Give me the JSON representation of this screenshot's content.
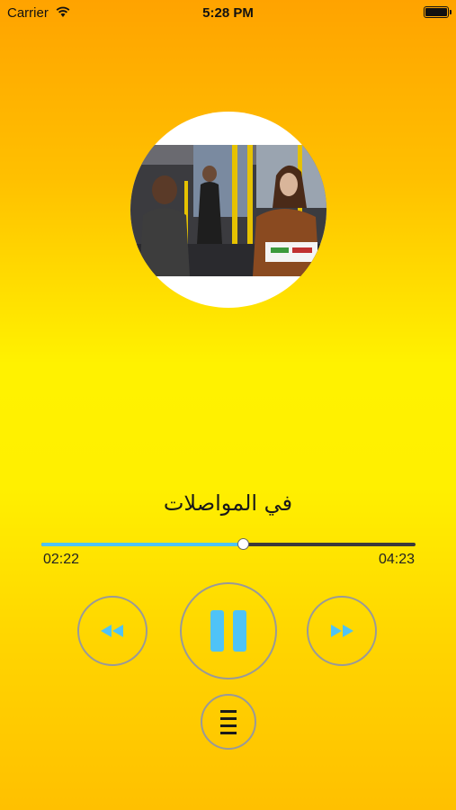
{
  "status_bar": {
    "carrier": "Carrier",
    "time": "5:28 PM",
    "icons": [
      "wifi-icon",
      "battery-icon"
    ]
  },
  "player": {
    "track_title": "في المواصلات",
    "elapsed": "02:22",
    "duration": "04:23",
    "progress_fraction": 0.54,
    "state": "playing"
  },
  "colors": {
    "accent": "#4fc3f7",
    "track_bg": "#3a3a3a",
    "button_border": "#999999",
    "background_top": "#ffa300",
    "background_mid": "#fff200"
  },
  "controls": {
    "icons": [
      "rewind-icon",
      "pause-icon",
      "fast-forward-icon",
      "menu-list-icon"
    ]
  }
}
